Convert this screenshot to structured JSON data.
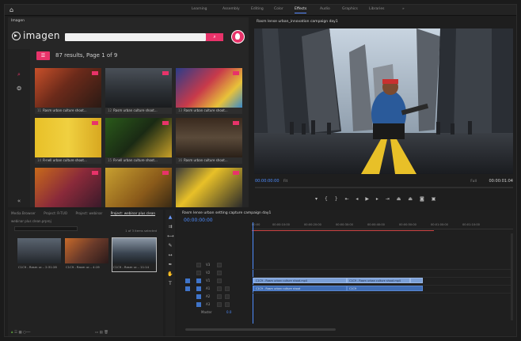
{
  "workspaces": [
    "Learning",
    "Assembly",
    "Editing",
    "Color",
    "Effects",
    "Audio",
    "Graphics",
    "Libraries"
  ],
  "active_workspace": "Effects",
  "imagen": {
    "tab": "Imagen",
    "brand": "imagen",
    "results": "87 results, Page 1 of 9",
    "thumbs": [
      {
        "num": "11",
        "caption": "Rasm urban culture shoot..."
      },
      {
        "num": "12",
        "caption": "Rasm urban culture shoot..."
      },
      {
        "num": "13",
        "caption": "Rasm urban culture shoot..."
      },
      {
        "num": "14",
        "caption": "R-nell urban culture shoot..."
      },
      {
        "num": "15",
        "caption": "R-nell urban culture shoot..."
      },
      {
        "num": "16",
        "caption": "Rasm urban culture shoot..."
      }
    ]
  },
  "monitor": {
    "tab": "Rasm lense urban_innovation campaign day1",
    "tc_left": "00:00:00:00",
    "fit": "Fit",
    "full": "Full",
    "tc_right": "00:00:01:04"
  },
  "project": {
    "tabs": [
      "Media Browser",
      "Project: R-TUO",
      "Project: webinar",
      "Project: webinar plus clean"
    ],
    "path": "webinar plus clean.prproj",
    "items": "1 of 3 items selected",
    "clips": [
      {
        "caption": "C1C9 - Rasm ur...",
        "dur": "2:31:28"
      },
      {
        "caption": "C1C9 - Rasm ur...",
        "dur": "4:19"
      },
      {
        "caption": "C1C9 - Rasm ur...",
        "dur": "11:14"
      }
    ]
  },
  "timeline": {
    "tab": "Rasm lense urban setting capture campaign day1",
    "tc": "00:00:00:00",
    "ruler": [
      "00:00",
      "00:00:10:00",
      "00:00:20:00",
      "00:00:30:00",
      "00:00:40:00",
      "00:00:50:00",
      "00:01:00:00",
      "00:01:10:00"
    ],
    "tracks_v": [
      "V3",
      "V2",
      "V1"
    ],
    "tracks_a": [
      "A1",
      "A2",
      "A3"
    ],
    "mix": "Master",
    "mix_val": "0.0",
    "clip_v1": "C1C9 - Rasm urban culture shoot.mp4",
    "clip_v1b": "C1C9 - Rasm urban culture shoot.mp4",
    "clip_a1": "C1C9 - Rasm urban culture shoot",
    "clip_a1b": "C1C9"
  }
}
